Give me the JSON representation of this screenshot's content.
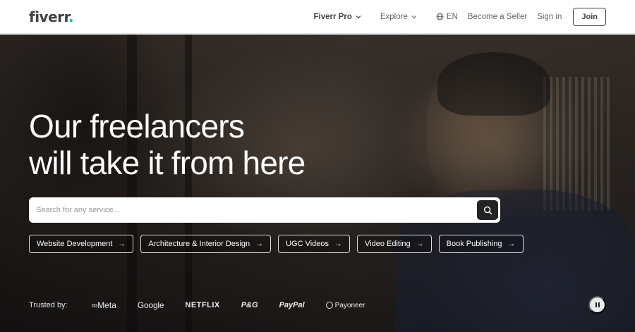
{
  "header": {
    "logo_text": "fiverr",
    "logo_dot": ".",
    "nav": {
      "fiverr_pro": "Fiverr Pro",
      "explore": "Explore",
      "language": "EN",
      "become_seller": "Become a Seller",
      "sign_in": "Sign in",
      "join": "Join"
    }
  },
  "hero": {
    "headline_line1": "Our freelancers",
    "headline_line2": "will take it from here",
    "search": {
      "placeholder": "Search for any service...",
      "value": ""
    },
    "chips": [
      {
        "label": "Website Development"
      },
      {
        "label": "Architecture & Interior Design"
      },
      {
        "label": "UGC Videos"
      },
      {
        "label": "Video Editing"
      },
      {
        "label": "Book Publishing"
      }
    ],
    "trusted": {
      "label": "Trusted by:",
      "brands": [
        "Meta",
        "Google",
        "NETFLIX",
        "P&G",
        "PayPal",
        "Payoneer"
      ]
    }
  },
  "icons": {
    "chevron": "chevron-down-icon",
    "globe": "globe-icon",
    "search": "search-icon",
    "arrow": "arrow-right-icon",
    "pause": "pause-icon"
  },
  "colors": {
    "brand_green": "#1dbf73",
    "text_dark": "#404145",
    "search_button": "#222325"
  }
}
